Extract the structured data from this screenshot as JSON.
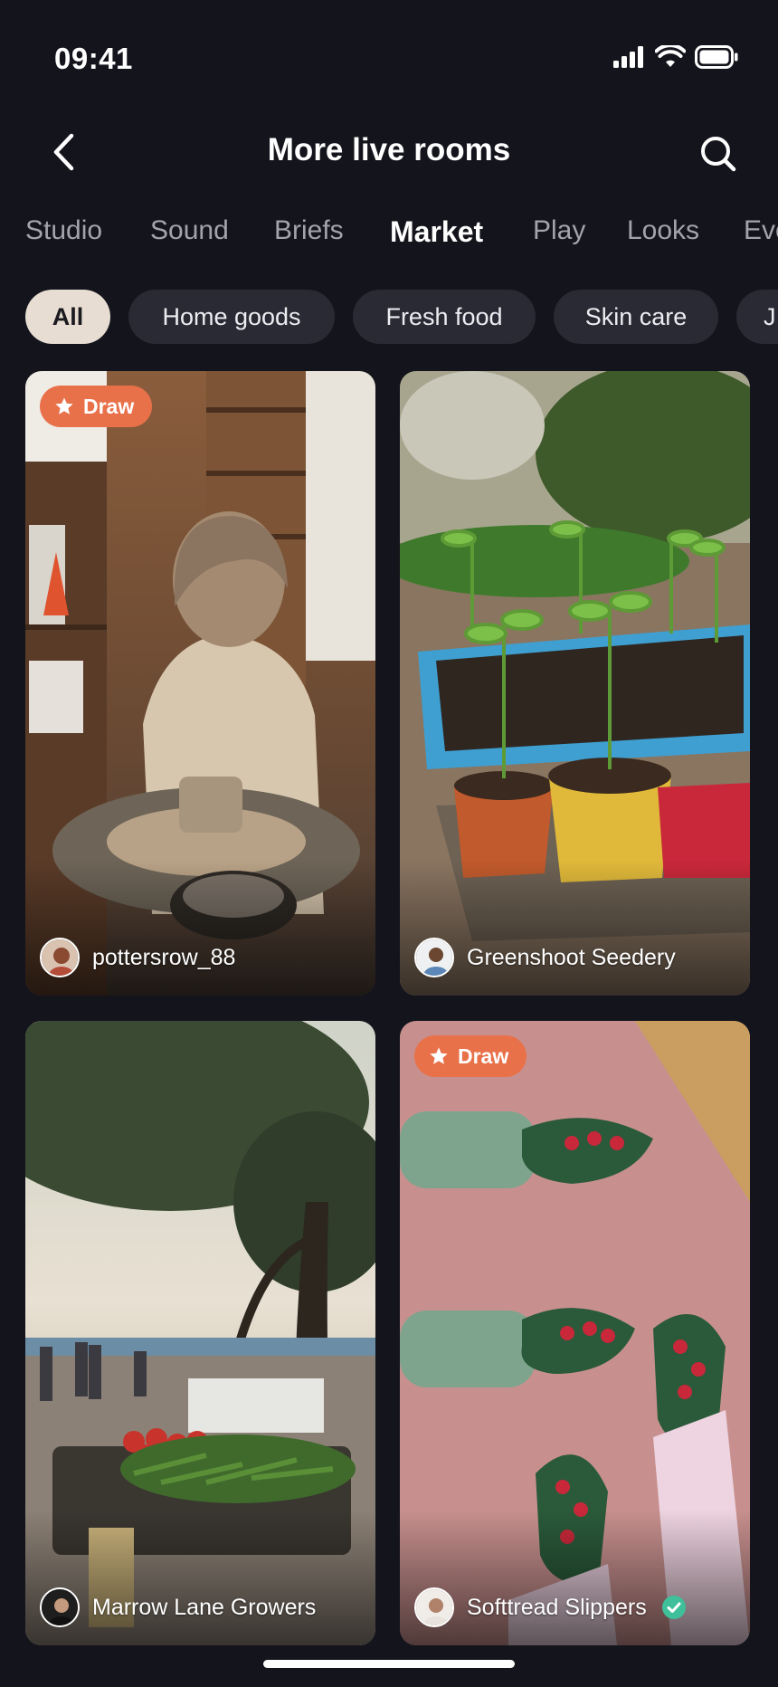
{
  "status": {
    "time": "09:41"
  },
  "header": {
    "title": "More live rooms"
  },
  "tabs": [
    {
      "label": "Studio"
    },
    {
      "label": "Sound"
    },
    {
      "label": "Briefs"
    },
    {
      "label": "Market"
    },
    {
      "label": "Play"
    },
    {
      "label": "Looks"
    },
    {
      "label": "Eve"
    }
  ],
  "active_tab": "Market",
  "chips": [
    {
      "label": "All"
    },
    {
      "label": "Home goods"
    },
    {
      "label": "Fresh food"
    },
    {
      "label": "Skin care"
    },
    {
      "label": "J"
    }
  ],
  "active_chip": "All",
  "cards": [
    {
      "badge": "Draw",
      "host": "pottersrow_88"
    },
    {
      "badge": "",
      "host": "Greenshoot Seedery"
    },
    {
      "badge": "",
      "host": "Marrow Lane Growers"
    },
    {
      "badge": "Draw",
      "host": "Softtread Slippers",
      "verified": true
    }
  ],
  "colors": {
    "background": "#14141c",
    "chip_active": "#e7ddd2",
    "chip_inactive": "#2a2a34",
    "draw_badge": "#e8714a",
    "verified": "#3fbf9a"
  }
}
